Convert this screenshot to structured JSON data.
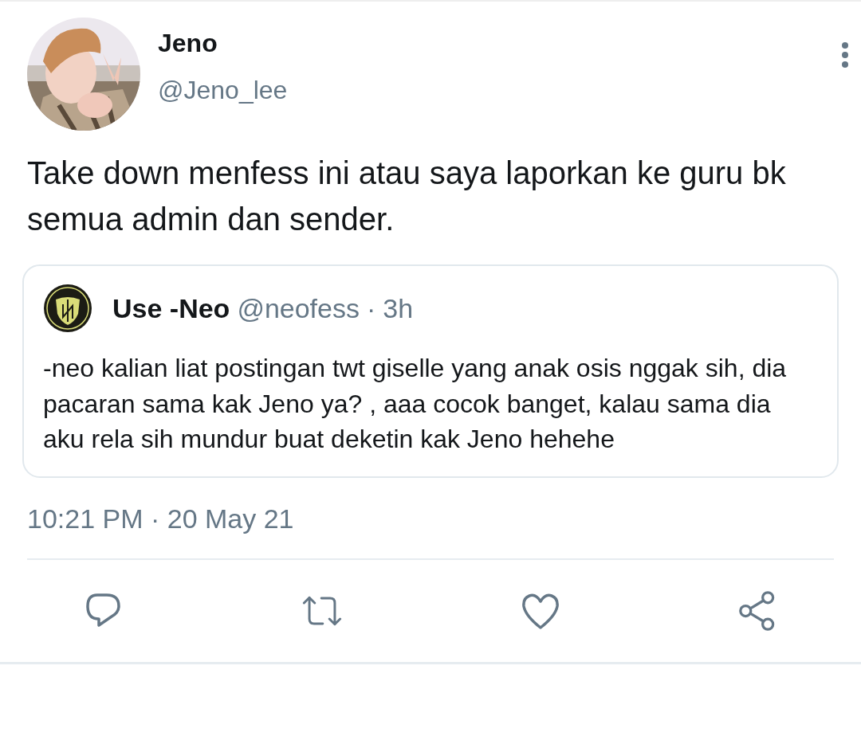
{
  "tweet": {
    "author": {
      "name": "Jeno",
      "handle": "@Jeno_lee"
    },
    "text": "Take down menfess ini atau saya laporkan ke guru bk semua admin dan sender.",
    "quoted": {
      "name": "Use -Neo",
      "handle": "@neofess",
      "separator": "·",
      "time": "3h",
      "text": "-neo kalian liat postingan twt giselle yang anak osis nggak sih, dia pacaran sama kak Jeno ya? , aaa cocok banget, kalau sama dia aku rela sih mundur buat deketin kak Jeno hehehe"
    },
    "timestamp": "10:21 PM · 20 May 21",
    "actions": [
      {
        "kind": "reply"
      },
      {
        "kind": "retweet"
      },
      {
        "kind": "like"
      },
      {
        "kind": "share"
      }
    ]
  }
}
